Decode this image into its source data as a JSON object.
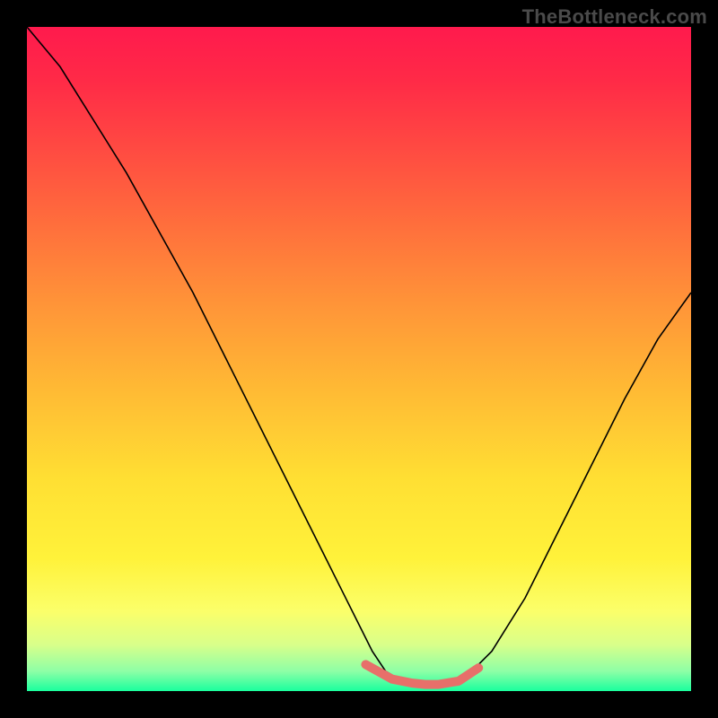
{
  "watermark": "TheBottleneck.com",
  "colors": {
    "gradient_top": "#ff1a4d",
    "gradient_bottom": "#1aff9e",
    "curve": "#000000",
    "bottom_marker": "#e76f6a",
    "frame": "#000000"
  },
  "chart_data": {
    "type": "line",
    "title": "",
    "xlabel": "",
    "ylabel": "",
    "xlim": [
      0,
      100
    ],
    "ylim": [
      0,
      100
    ],
    "annotations": [
      "TheBottleneck.com"
    ],
    "series": [
      {
        "name": "V-curve",
        "x": [
          0,
          5,
          10,
          15,
          20,
          25,
          30,
          35,
          40,
          45,
          50,
          52,
          54,
          56,
          58,
          60,
          62,
          64,
          66,
          70,
          75,
          80,
          85,
          90,
          95,
          100
        ],
        "y": [
          100,
          94,
          86,
          78,
          69,
          60,
          50,
          40,
          30,
          20,
          10,
          6,
          3,
          1.8,
          1.2,
          1.0,
          1.0,
          1.2,
          2,
          6,
          14,
          24,
          34,
          44,
          53,
          60
        ]
      },
      {
        "name": "bottom-marker",
        "x": [
          51,
          55,
          58,
          60,
          62,
          65,
          68
        ],
        "y": [
          4,
          1.8,
          1.2,
          1.0,
          1.0,
          1.5,
          3.5
        ]
      }
    ]
  }
}
